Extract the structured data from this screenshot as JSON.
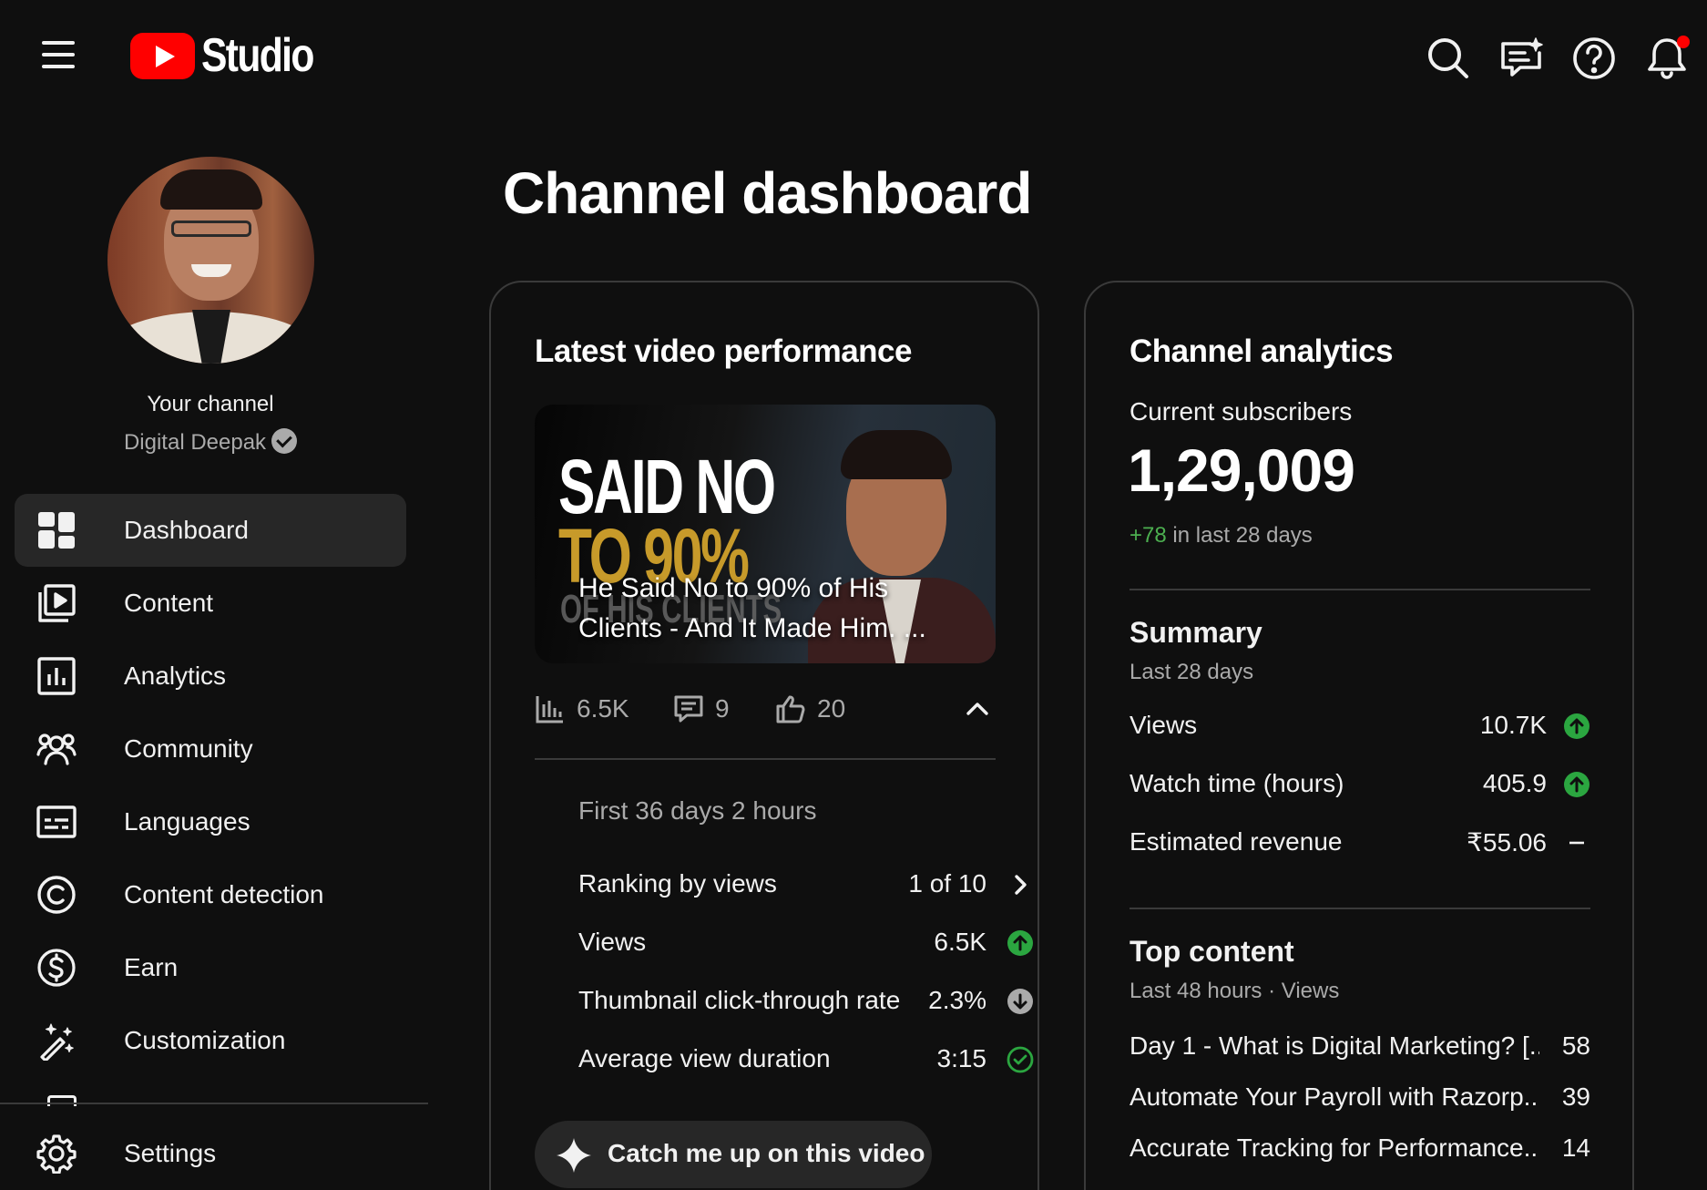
{
  "app": {
    "logo_text": "Studio"
  },
  "topbar": {
    "icons": [
      "search-icon",
      "feedback-icon",
      "help-icon",
      "notifications-icon"
    ],
    "notification_dot_color": "#ff0000"
  },
  "sidebar": {
    "channel_label": "Your channel",
    "channel_name": "Digital Deepak",
    "items": [
      {
        "label": "Dashboard",
        "icon": "dashboard-icon",
        "active": true
      },
      {
        "label": "Content",
        "icon": "content-icon"
      },
      {
        "label": "Analytics",
        "icon": "analytics-icon"
      },
      {
        "label": "Community",
        "icon": "community-icon"
      },
      {
        "label": "Languages",
        "icon": "subtitles-icon"
      },
      {
        "label": "Content detection",
        "icon": "copyright-icon"
      },
      {
        "label": "Earn",
        "icon": "dollar-icon"
      },
      {
        "label": "Customization",
        "icon": "magic-wand-icon"
      }
    ],
    "settings_label": "Settings"
  },
  "main": {
    "page_title": "Channel dashboard"
  },
  "latest_video": {
    "title": "Latest video performance",
    "thumbnail_text": {
      "line1": "SAID NO",
      "line2": "TO 90%",
      "line3": "OF HIS CLIENTS"
    },
    "video_title": "He Said No to 90% of His Clients - And It Made Him. ...",
    "stats": {
      "views": "6.5K",
      "comments": "9",
      "likes": "20"
    },
    "period": "First 36 days 2 hours",
    "metrics": [
      {
        "label": "Ranking by views",
        "value": "1 of 10",
        "indicator": "chevron-right-icon"
      },
      {
        "label": "Views",
        "value": "6.5K",
        "indicator": "arrow-up-icon",
        "color": "#2ba640"
      },
      {
        "label": "Thumbnail click-through rate",
        "value": "2.3%",
        "indicator": "arrow-down-icon",
        "color": "#aaaaaa"
      },
      {
        "label": "Average view duration",
        "value": "3:15",
        "indicator": "check-circle-icon",
        "color": "#2ba640"
      }
    ],
    "catchup_label": "Catch me up on this video"
  },
  "channel_analytics": {
    "title": "Channel analytics",
    "subscribers_label": "Current subscribers",
    "subscribers": "1,29,009",
    "delta_value": "+78",
    "delta_text": " in last 28 days",
    "delta_color": "#4caf50",
    "summary_title": "Summary",
    "summary_period": "Last 28 days",
    "summary": [
      {
        "label": "Views",
        "value": "10.7K",
        "indicator": "arrow-up-icon"
      },
      {
        "label": "Watch time (hours)",
        "value": "405.9",
        "indicator": "arrow-up-icon"
      },
      {
        "label": "Estimated revenue",
        "value": "₹55.06",
        "indicator": "dash-icon"
      }
    ],
    "top_content_title": "Top content",
    "top_content_period": "Last 48 hours · Views",
    "top_content": [
      {
        "title": "Day 1 - What is Digital Marketing? [...",
        "views": "58"
      },
      {
        "title": "Automate Your Payroll with Razorp...",
        "views": "39"
      },
      {
        "title": "Accurate Tracking for Performance...",
        "views": "14"
      }
    ]
  }
}
